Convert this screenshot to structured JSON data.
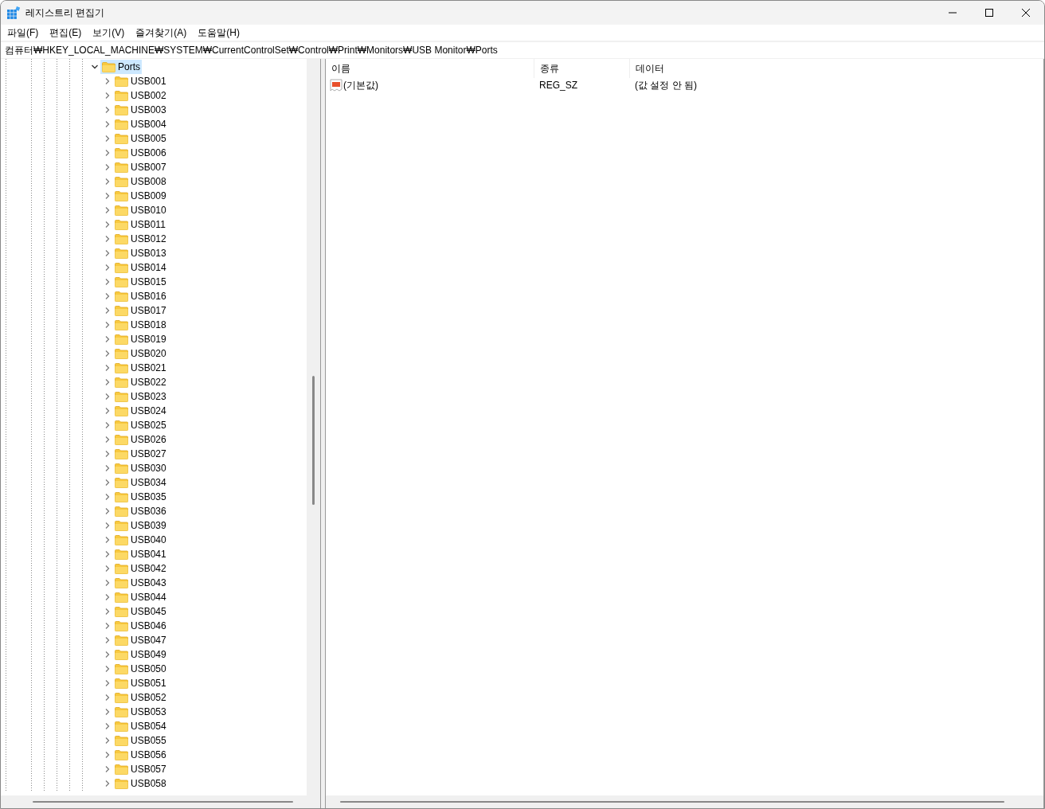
{
  "window": {
    "title": "레지스트리 편집기"
  },
  "menu": [
    "파일(F)",
    "편집(E)",
    "보기(V)",
    "즐겨찾기(A)",
    "도움말(H)"
  ],
  "address": "컴퓨터₩HKEY_LOCAL_MACHINE₩SYSTEM₩CurrentControlSet₩Control₩Print₩Monitors₩USB Monitor₩Ports",
  "tree": {
    "label": "Ports",
    "expanded": true,
    "selected": true,
    "children": [
      {
        "label": "USB001",
        "expanded": false,
        "selected": false
      },
      {
        "label": "USB002",
        "expanded": false,
        "selected": false
      },
      {
        "label": "USB003",
        "expanded": false,
        "selected": false
      },
      {
        "label": "USB004",
        "expanded": false,
        "selected": false
      },
      {
        "label": "USB005",
        "expanded": false,
        "selected": false
      },
      {
        "label": "USB006",
        "expanded": false,
        "selected": false
      },
      {
        "label": "USB007",
        "expanded": false,
        "selected": false
      },
      {
        "label": "USB008",
        "expanded": false,
        "selected": false
      },
      {
        "label": "USB009",
        "expanded": false,
        "selected": false
      },
      {
        "label": "USB010",
        "expanded": false,
        "selected": false
      },
      {
        "label": "USB011",
        "expanded": false,
        "selected": false
      },
      {
        "label": "USB012",
        "expanded": false,
        "selected": false
      },
      {
        "label": "USB013",
        "expanded": false,
        "selected": false
      },
      {
        "label": "USB014",
        "expanded": false,
        "selected": false
      },
      {
        "label": "USB015",
        "expanded": false,
        "selected": false
      },
      {
        "label": "USB016",
        "expanded": false,
        "selected": false
      },
      {
        "label": "USB017",
        "expanded": false,
        "selected": false
      },
      {
        "label": "USB018",
        "expanded": false,
        "selected": false
      },
      {
        "label": "USB019",
        "expanded": false,
        "selected": false
      },
      {
        "label": "USB020",
        "expanded": false,
        "selected": false
      },
      {
        "label": "USB021",
        "expanded": false,
        "selected": false
      },
      {
        "label": "USB022",
        "expanded": false,
        "selected": false
      },
      {
        "label": "USB023",
        "expanded": false,
        "selected": false
      },
      {
        "label": "USB024",
        "expanded": false,
        "selected": false
      },
      {
        "label": "USB025",
        "expanded": false,
        "selected": false
      },
      {
        "label": "USB026",
        "expanded": false,
        "selected": false
      },
      {
        "label": "USB027",
        "expanded": false,
        "selected": false
      },
      {
        "label": "USB030",
        "expanded": false,
        "selected": false
      },
      {
        "label": "USB034",
        "expanded": false,
        "selected": false
      },
      {
        "label": "USB035",
        "expanded": false,
        "selected": false
      },
      {
        "label": "USB036",
        "expanded": false,
        "selected": false
      },
      {
        "label": "USB039",
        "expanded": false,
        "selected": false
      },
      {
        "label": "USB040",
        "expanded": false,
        "selected": false
      },
      {
        "label": "USB041",
        "expanded": false,
        "selected": false
      },
      {
        "label": "USB042",
        "expanded": false,
        "selected": false
      },
      {
        "label": "USB043",
        "expanded": false,
        "selected": false
      },
      {
        "label": "USB044",
        "expanded": false,
        "selected": false
      },
      {
        "label": "USB045",
        "expanded": false,
        "selected": false
      },
      {
        "label": "USB046",
        "expanded": false,
        "selected": false
      },
      {
        "label": "USB047",
        "expanded": false,
        "selected": false
      },
      {
        "label": "USB049",
        "expanded": false,
        "selected": false
      },
      {
        "label": "USB050",
        "expanded": false,
        "selected": false
      },
      {
        "label": "USB051",
        "expanded": false,
        "selected": false
      },
      {
        "label": "USB052",
        "expanded": false,
        "selected": false
      },
      {
        "label": "USB053",
        "expanded": false,
        "selected": false
      },
      {
        "label": "USB054",
        "expanded": false,
        "selected": false
      },
      {
        "label": "USB055",
        "expanded": false,
        "selected": false
      },
      {
        "label": "USB056",
        "expanded": false,
        "selected": false
      },
      {
        "label": "USB057",
        "expanded": false,
        "selected": false
      },
      {
        "label": "USB058",
        "expanded": false,
        "selected": false
      }
    ]
  },
  "values": {
    "columns": [
      "이름",
      "종류",
      "데이터"
    ],
    "rows": [
      {
        "name": "(기본값)",
        "type": "REG_SZ",
        "data": "(값 설정 안 됨)",
        "kind": "string"
      }
    ]
  }
}
